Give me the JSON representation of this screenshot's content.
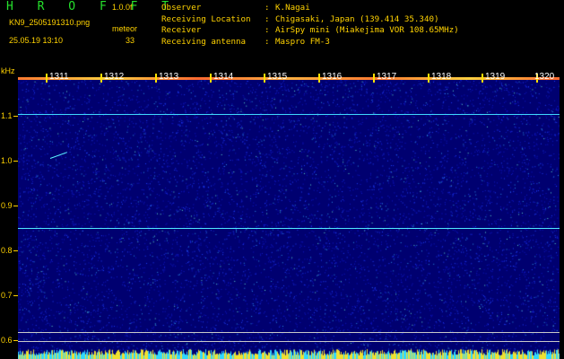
{
  "header": {
    "app_title": "H R O F F T",
    "version": "1.0.0f",
    "filename": "KN9_2505191310.png",
    "mode": "meteor",
    "datetime": "25.05.19 13:10",
    "count": "33"
  },
  "info": [
    {
      "key": "Observer",
      "value": "K.Nagai"
    },
    {
      "key": "Receiving Location",
      "value": "Chigasaki, Japan (139.414 35.340)"
    },
    {
      "key": "Receiver",
      "value": "AirSpy mini (Miakejima VOR 108.65MHz)"
    },
    {
      "key": "Receiving antenna",
      "value": "Maspro FM-3"
    }
  ],
  "y_axis": {
    "unit": "kHz",
    "labels": [
      "1.1",
      "1.0",
      "0.9",
      "0.8",
      "0.7",
      "0.6"
    ]
  },
  "x_axis": {
    "labels": [
      "1311",
      "1312",
      "1313",
      "1314",
      "1315",
      "1316",
      "1317",
      "1318",
      "1319",
      "1320"
    ]
  },
  "colors": {
    "label": "#ffd200",
    "title": "#25e02c",
    "background": "#00006a",
    "carrier": "#4fe0ff"
  }
}
